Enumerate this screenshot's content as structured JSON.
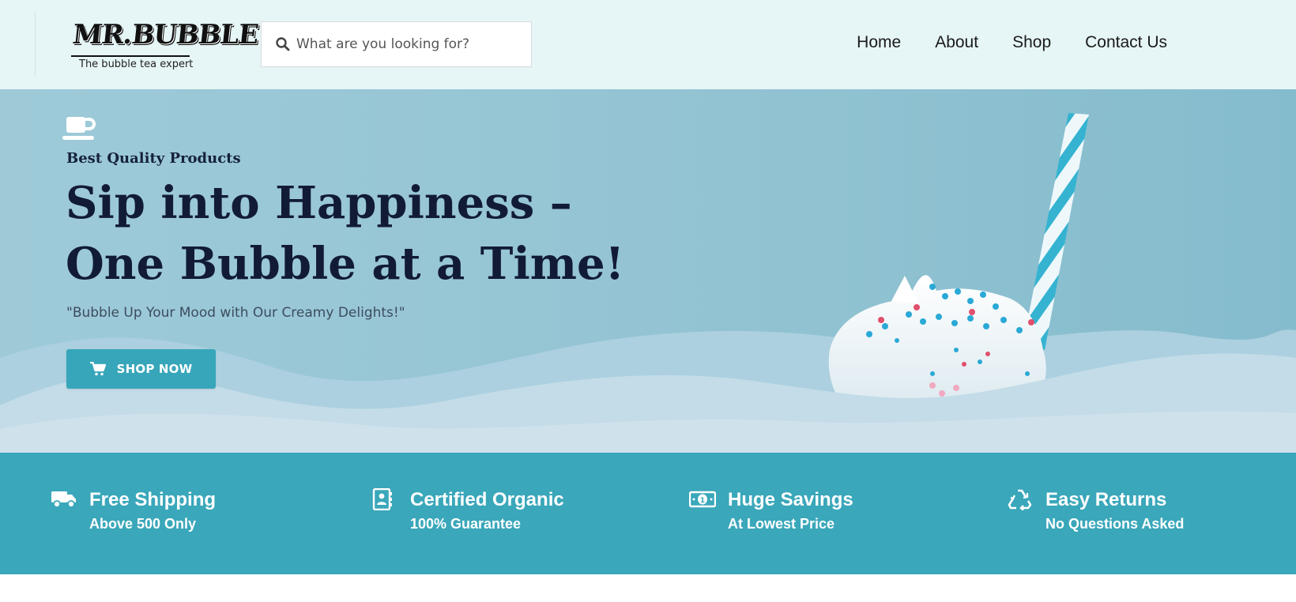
{
  "header": {
    "logo": {
      "mark": "MR.BUBBLE",
      "tagline": "The bubble tea expert"
    },
    "search": {
      "placeholder": "What are you looking for?",
      "value": ""
    },
    "nav": [
      "Home",
      "About",
      "Shop",
      "Contact Us"
    ]
  },
  "hero": {
    "eyebrow_icon": "coffee-cup-icon",
    "eyebrow": "Best Quality Products",
    "title_line1": "Sip into Happiness –",
    "title_line2": "One Bubble at a Time!",
    "subtitle": "\"Bubble Up Your Mood with Our Creamy Delights!\"",
    "cta": {
      "label": "SHOP NOW",
      "icon": "shopping-cart-icon"
    }
  },
  "features": [
    {
      "icon": "truck-icon",
      "title": "Free Shipping",
      "subtitle": "Above 500 Only"
    },
    {
      "icon": "contact-book-icon",
      "title": "Certified Organic",
      "subtitle": "100% Guarantee"
    },
    {
      "icon": "money-bill-icon",
      "title": "Huge Savings",
      "subtitle": "At Lowest Price"
    },
    {
      "icon": "recycle-icon",
      "title": "Easy Returns",
      "subtitle": "No Questions Asked"
    }
  ],
  "colors": {
    "header_bg": "#e6f5f6",
    "hero_bg": "#94c4d3",
    "accent": "#3aa7ba",
    "heading": "#121b36"
  }
}
